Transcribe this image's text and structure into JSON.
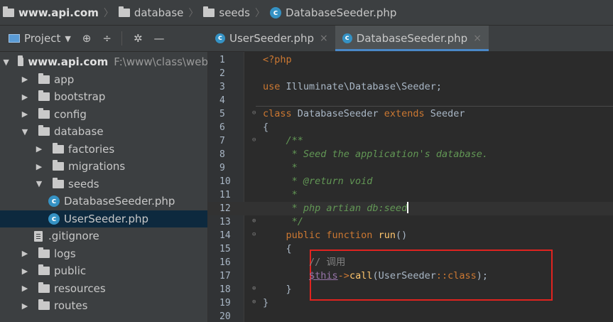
{
  "breadcrumb": {
    "root": "www.api.com",
    "items": [
      "database",
      "seeds"
    ],
    "file": "DatabaseSeeder.php"
  },
  "project_panel": {
    "title": "Project",
    "tool_icons": [
      "target-icon",
      "collapse-icon",
      "gear-icon",
      "minimize-icon"
    ]
  },
  "tabs": [
    {
      "label": "UserSeeder.php",
      "active": false
    },
    {
      "label": "DatabaseSeeder.php",
      "active": true
    }
  ],
  "tree": [
    {
      "name": "www.api.com",
      "path": "F:\\www\\class\\web",
      "type": "folder",
      "bold": true,
      "expanded": true,
      "depth": 0
    },
    {
      "name": "app",
      "type": "folder",
      "depth": 1,
      "expanded": false
    },
    {
      "name": "bootstrap",
      "type": "folder",
      "depth": 1,
      "expanded": false
    },
    {
      "name": "config",
      "type": "folder",
      "depth": 1,
      "expanded": false
    },
    {
      "name": "database",
      "type": "folder",
      "depth": 1,
      "expanded": true
    },
    {
      "name": "factories",
      "type": "folder",
      "depth": 2,
      "expanded": false
    },
    {
      "name": "migrations",
      "type": "folder",
      "depth": 2,
      "expanded": false
    },
    {
      "name": "seeds",
      "type": "folder",
      "depth": 2,
      "expanded": true
    },
    {
      "name": "DatabaseSeeder.php",
      "type": "class",
      "depth": 3
    },
    {
      "name": "UserSeeder.php",
      "type": "class",
      "depth": 3,
      "selected": true
    },
    {
      "name": ".gitignore",
      "type": "file",
      "depth": 2
    },
    {
      "name": "logs",
      "type": "folder",
      "depth": 1,
      "expanded": false
    },
    {
      "name": "public",
      "type": "folder",
      "depth": 1,
      "expanded": false
    },
    {
      "name": "resources",
      "type": "folder",
      "depth": 1,
      "expanded": false
    },
    {
      "name": "routes",
      "type": "folder",
      "depth": 1,
      "expanded": false
    }
  ],
  "editor": {
    "lines": [
      {
        "n": "1",
        "parts": [
          [
            "tag",
            "<?php"
          ]
        ]
      },
      {
        "n": "2",
        "parts": []
      },
      {
        "n": "3",
        "parts": [
          [
            "kw",
            "use "
          ],
          [
            "",
            "Illuminate\\Database\\Seeder;"
          ]
        ]
      },
      {
        "n": "4",
        "parts": []
      },
      {
        "n": "5",
        "parts": [
          [
            "kw",
            "class "
          ],
          [
            "",
            "DatabaseSeeder "
          ],
          [
            "kw",
            "extends "
          ],
          [
            "",
            "Seeder"
          ]
        ]
      },
      {
        "n": "6",
        "parts": [
          [
            "",
            "{"
          ]
        ]
      },
      {
        "n": "7",
        "parts": [
          [
            "dc",
            "    /**"
          ]
        ]
      },
      {
        "n": "8",
        "parts": [
          [
            "dc",
            "     * Seed the application's database."
          ]
        ]
      },
      {
        "n": "9",
        "parts": [
          [
            "dc",
            "     *"
          ]
        ]
      },
      {
        "n": "10",
        "parts": [
          [
            "dc",
            "     * @return void"
          ]
        ]
      },
      {
        "n": "11",
        "parts": [
          [
            "dc",
            "     *"
          ]
        ]
      },
      {
        "n": "12",
        "parts": [
          [
            "dc",
            "     * php artian db:seed"
          ]
        ],
        "current": true
      },
      {
        "n": "13",
        "parts": [
          [
            "dc",
            "     */"
          ]
        ]
      },
      {
        "n": "14",
        "parts": [
          [
            "kw",
            "    public function "
          ],
          [
            "fn",
            "run"
          ],
          [
            "",
            "()"
          ]
        ]
      },
      {
        "n": "15",
        "parts": [
          [
            "",
            "    {"
          ]
        ]
      },
      {
        "n": "16",
        "parts": [
          [
            "cmt2",
            "        // 调用"
          ]
        ]
      },
      {
        "n": "17",
        "parts": [
          [
            "",
            "        "
          ],
          [
            "var",
            "$this"
          ],
          [
            "kw",
            "->"
          ],
          [
            "fn",
            "call"
          ],
          [
            "",
            "(UserSeeder"
          ],
          [
            "kw",
            "::"
          ],
          [
            "kw",
            "class"
          ],
          [
            "",
            ");"
          ]
        ]
      },
      {
        "n": "18",
        "parts": [
          [
            "",
            "    }"
          ]
        ]
      },
      {
        "n": "19",
        "parts": [
          [
            "",
            "}"
          ]
        ]
      },
      {
        "n": "20",
        "parts": []
      }
    ]
  }
}
